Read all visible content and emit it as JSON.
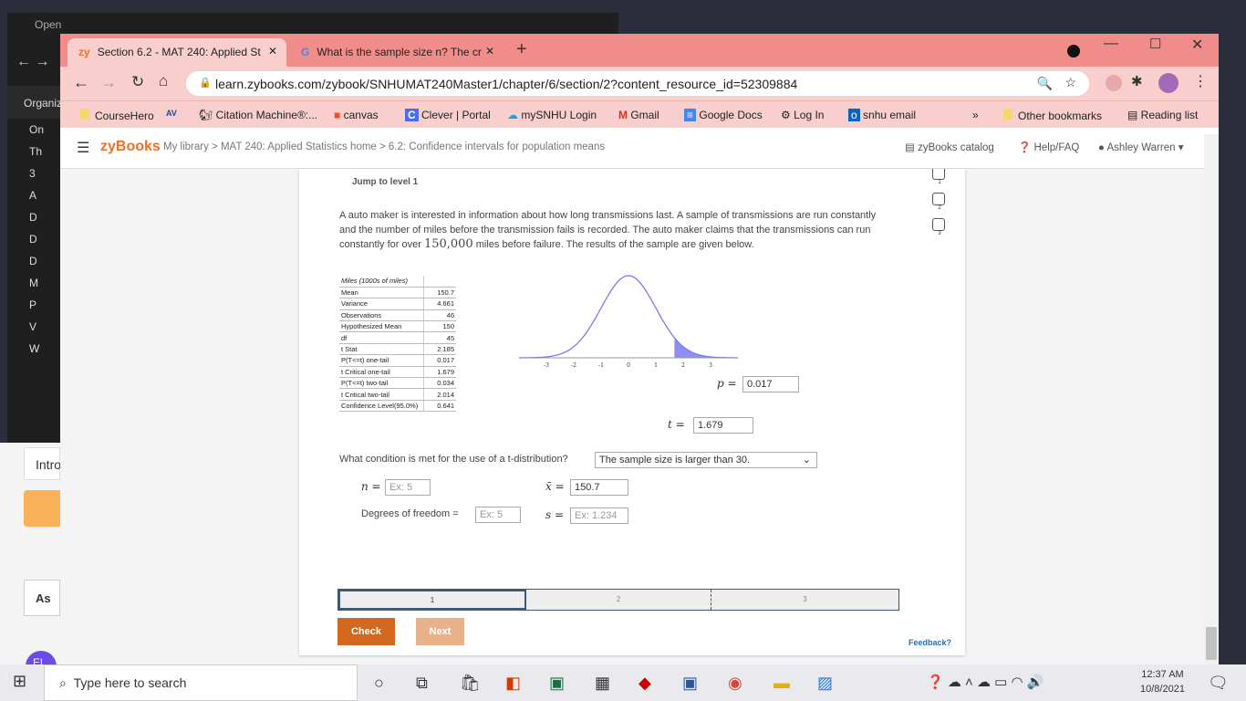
{
  "background_window": {
    "title": "Open",
    "organize": "Organiz",
    "sidebar": [
      "On",
      "Th",
      "3",
      "A",
      "D",
      "D",
      "D",
      "M",
      "P",
      "V",
      "W"
    ],
    "peek_items": [
      "Intro",
      "As",
      "El"
    ]
  },
  "browser": {
    "tabs": [
      {
        "label": "Section 6.2 - MAT 240: Applied St",
        "icon": "zy"
      },
      {
        "label": "What is the sample size n? The cr",
        "icon": "G"
      }
    ],
    "url": "learn.zybooks.com/zybook/SNHUMAT240Master1/chapter/6/section/2?content_resource_id=52309884",
    "bookmarks": [
      "CourseHero",
      "Citation Machine®:...",
      "canvas",
      "Clever | Portal",
      "mySNHU Login",
      "Gmail",
      "Google Docs",
      "Log In",
      "snhu email"
    ],
    "other_bookmarks": "Other bookmarks",
    "reading_list": "Reading list",
    "more": "»"
  },
  "zybooks": {
    "logo": "zyBooks",
    "breadcrumb": "My library > MAT 240: Applied Statistics home > 6.2: Confidence intervals for population means",
    "catalog": "zyBooks catalog",
    "help": "Help/FAQ",
    "user": "Ashley Warren"
  },
  "activity": {
    "jump": "Jump to level 1",
    "prompt_a": "A auto maker is interested in information about how long transmissions last. A sample of transmissions are run constantly and the number of miles before the transmission fails is recorded. The auto maker claims that the transmissions can run constantly for over ",
    "prompt_num": "150,000",
    "prompt_b": " miles before failure. The results of the sample are given below.",
    "levels": [
      "1",
      "2",
      "3"
    ],
    "table": {
      "header": "Miles (1000s of miles)",
      "rows": [
        [
          "Mean",
          "150.7"
        ],
        [
          "Variance",
          "4.661"
        ],
        [
          "Observations",
          "46"
        ],
        [
          "Hypothesized Mean",
          "150"
        ],
        [
          "df",
          "45"
        ],
        [
          "t Stat",
          "2.185"
        ],
        [
          "P(T<=t) one-tail",
          "0.017"
        ],
        [
          "t Critical one-tail",
          "1.679"
        ],
        [
          "P(T<=t) two-tail",
          "0.034"
        ],
        [
          "t Critical two-tail",
          "2.014"
        ],
        [
          "Confidence Level(95.0%)",
          "0.641"
        ]
      ]
    },
    "chart_data": {
      "type": "area",
      "description_curve": "t-distribution density",
      "x_ticks": [
        "-3",
        "-2",
        "-1",
        "0",
        "1",
        "2",
        "3"
      ],
      "xlim": [
        -4,
        4
      ],
      "shaded_from_t": 1.679,
      "p_label": "p =",
      "p_value": "0.017",
      "t_label": "t =",
      "t_value": "1.679",
      "curve_color": "#7b7bef"
    },
    "condition_q": "What condition is met for the use of a t-distribution?",
    "condition_value": "The sample size is larger than 30.",
    "n_label": "n =",
    "n_placeholder": "Ex: 5",
    "xbar_label": "x̄ =",
    "xbar_value": "150.7",
    "df_label": "Degrees of freedom =",
    "df_placeholder": "Ex: 5",
    "s_label": "s =",
    "s_placeholder": "Ex: 1.234",
    "progress": [
      "1",
      "2",
      "3"
    ],
    "check": "Check",
    "next": "Next",
    "feedback": "Feedback?"
  },
  "taskbar": {
    "search": "Type here to search",
    "time": "12:37 AM",
    "date": "10/8/2021"
  },
  "colors": {
    "tab_bar": "#f08d8a",
    "toolbar": "#f8cfcd",
    "zy_orange": "#f36f21",
    "check": "#d2691e",
    "next": "#e8b18a"
  }
}
